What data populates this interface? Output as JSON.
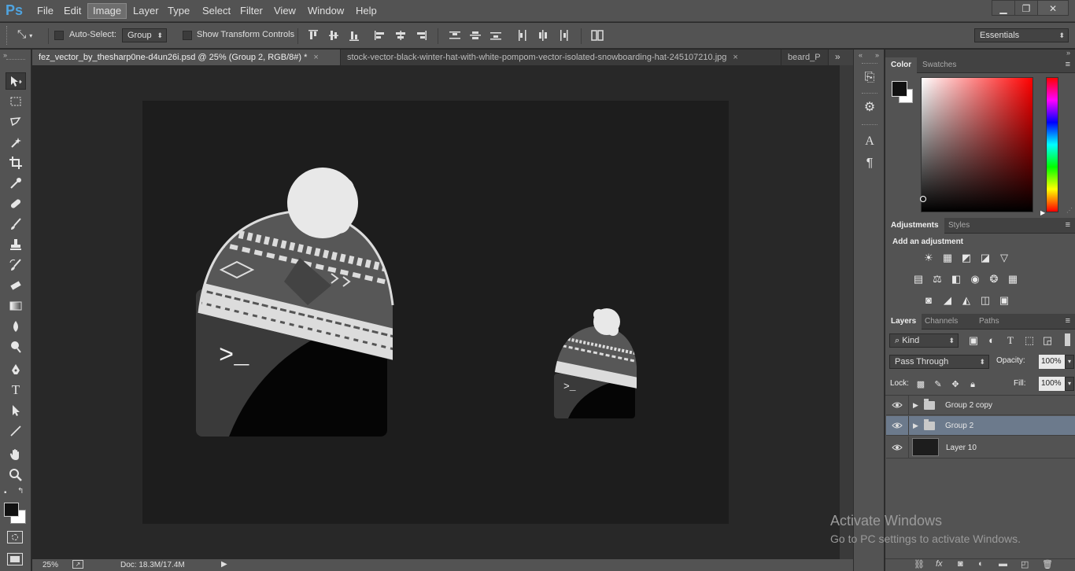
{
  "app": {
    "logo": "Ps",
    "menu": [
      "File",
      "Edit",
      "Image",
      "Layer",
      "Type",
      "Select",
      "Filter",
      "View",
      "Window",
      "Help"
    ],
    "active_menu": "Image",
    "window_controls": [
      "minimize",
      "restore",
      "close"
    ]
  },
  "options_bar": {
    "auto_select_label": "Auto-Select:",
    "auto_select_value": "Group",
    "show_transform_label": "Show Transform Controls",
    "workspace": "Essentials"
  },
  "tabs": [
    {
      "label": "fez_vector_by_thesharp0ne-d4un26i.psd @ 25% (Group 2, RGB/8#) *",
      "close": "×",
      "active": true
    },
    {
      "label": "stock-vector-black-winter-hat-with-white-pompom-vector-isolated-snowboarding-hat-245107210.jpg",
      "close": "×",
      "active": false
    },
    {
      "label": "beard_P",
      "close": "",
      "active": false
    }
  ],
  "canvas": {
    "large_prompt": ">_",
    "small_prompt": ">_"
  },
  "status": {
    "zoom": "25%",
    "doc": "Doc: 18.3M/17.4M"
  },
  "color_panel": {
    "tabs": [
      "Color",
      "Swatches"
    ],
    "foreground": "#111111",
    "background": "#ffffff"
  },
  "adjustments_panel": {
    "tabs": [
      "Adjustments",
      "Styles"
    ],
    "heading": "Add an adjustment"
  },
  "layers_panel": {
    "tabs": [
      "Layers",
      "Channels",
      "Paths"
    ],
    "filter_kind": "Kind",
    "blend_mode": "Pass Through",
    "opacity_label": "Opacity:",
    "opacity_value": "100%",
    "lock_label": "Lock:",
    "fill_label": "Fill:",
    "fill_value": "100%",
    "layers": [
      {
        "name": "Group 2 copy",
        "type": "group",
        "selected": false
      },
      {
        "name": "Group 2",
        "type": "group",
        "selected": true
      },
      {
        "name": "Layer 10",
        "type": "layer",
        "selected": false
      }
    ]
  },
  "watermark": {
    "line1": "Activate Windows",
    "line2": "Go to PC settings to activate Windows."
  },
  "colors": {
    "accent": "#4fa4e0",
    "selection": "#6c7a8c"
  }
}
